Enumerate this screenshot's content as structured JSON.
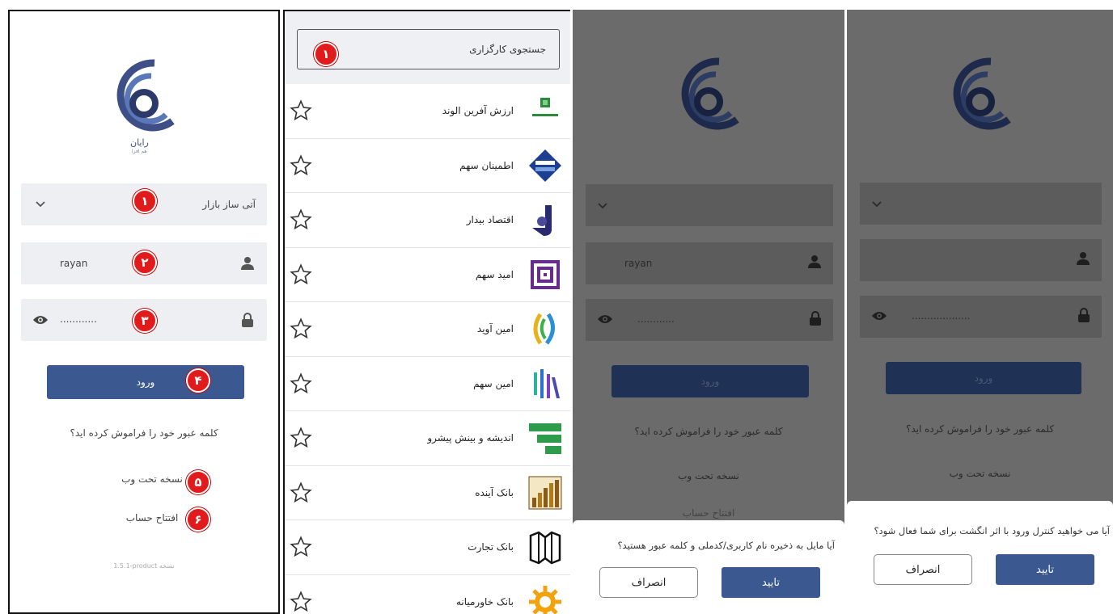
{
  "login": {
    "broker_label": "آتی ساز بازار",
    "username_value": "rayan",
    "password_value": "............",
    "login_button": "ورود",
    "forgot_password": "کلمه عبور خود را فراموش کرده اید؟",
    "web_version": "نسخه تحت وب",
    "open_account": "افتتاح حساب",
    "version_text": "1.5.1-product نسخه",
    "logo_text": "رایان",
    "logo_subtext": "هم افزا"
  },
  "badges": [
    "۱",
    "۲",
    "۳",
    "۴",
    "۵",
    "۶"
  ],
  "brokers": {
    "search_placeholder": "جستجوی کارگزاری",
    "badge": "۱",
    "items": [
      {
        "name": "ارزش آفرین الوند",
        "logo_icon": "arzesh-afarin-logo"
      },
      {
        "name": "اطمینان سهم",
        "logo_icon": "etminan-sahm-logo"
      },
      {
        "name": "اقتصاد بیدار",
        "logo_icon": "eghtesad-bidar-logo"
      },
      {
        "name": "امید سهم",
        "logo_icon": "omid-sahm-logo"
      },
      {
        "name": "امین آوید",
        "logo_icon": "amin-avid-logo"
      },
      {
        "name": "امین سهم",
        "logo_icon": "amin-sahm-logo"
      },
      {
        "name": "اندیشه و بینش پیشرو",
        "logo_icon": "andishe-binesh-logo"
      },
      {
        "name": "بانک آینده",
        "logo_icon": "bank-ayandeh-logo"
      },
      {
        "name": "بانک تجارت",
        "logo_icon": "bank-tejarat-logo"
      },
      {
        "name": "بانک خاورمیانه",
        "logo_icon": "bank-khavarmianeh-logo"
      }
    ]
  },
  "save_dialog": {
    "username_value": "rayan",
    "password_value": "............",
    "login_button": "ورود",
    "forgot_password": "کلمه عبور خود را فراموش کرده اید؟",
    "web_version": "نسخه تحت وب",
    "open_account": "افتتاح حساب",
    "question": "آیا مایل به ذخیره نام کاربری/کدملی و کلمه عبور هستید؟",
    "confirm": "تایید",
    "cancel": "انصراف"
  },
  "fingerprint_dialog": {
    "password_value": "...................",
    "login_button": "ورود",
    "forgot_password": "کلمه عبور خود را فراموش کرده اید؟",
    "web_version": "نسخه تحت وب",
    "question": "آیا می خواهید کنترل ورود با اثر انگشت برای شما فعال شود؟",
    "confirm": "تایید",
    "cancel": "انصراف"
  },
  "colors": {
    "primary": "#3b5891",
    "badge": "#e11b1b",
    "field_bg": "#eeeff2",
    "overlay": "#6b6b6b"
  }
}
